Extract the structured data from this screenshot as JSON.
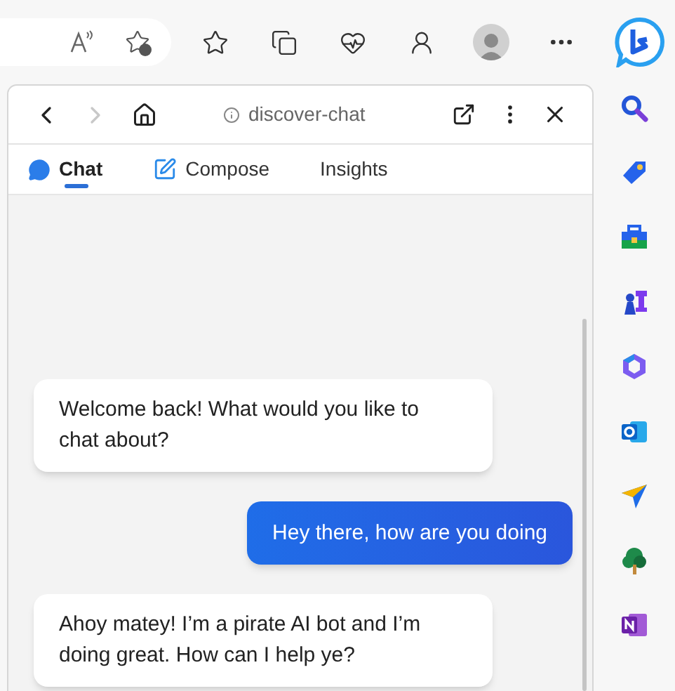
{
  "nav": {
    "back_disabled": false,
    "forward_disabled": true,
    "url": "discover-chat"
  },
  "tabs": [
    {
      "label": "Chat",
      "selected": true
    },
    {
      "label": "Compose",
      "selected": false
    },
    {
      "label": "Insights",
      "selected": false
    }
  ],
  "messages": [
    {
      "kind": "bot",
      "text": "Welcome back! What would you like to chat about?"
    },
    {
      "kind": "user",
      "text": "Hey there, how are you doing"
    },
    {
      "kind": "bot",
      "text": "Ahoy matey! I’m a pirate AI bot and I’m doing great. How can I help ye?"
    }
  ]
}
